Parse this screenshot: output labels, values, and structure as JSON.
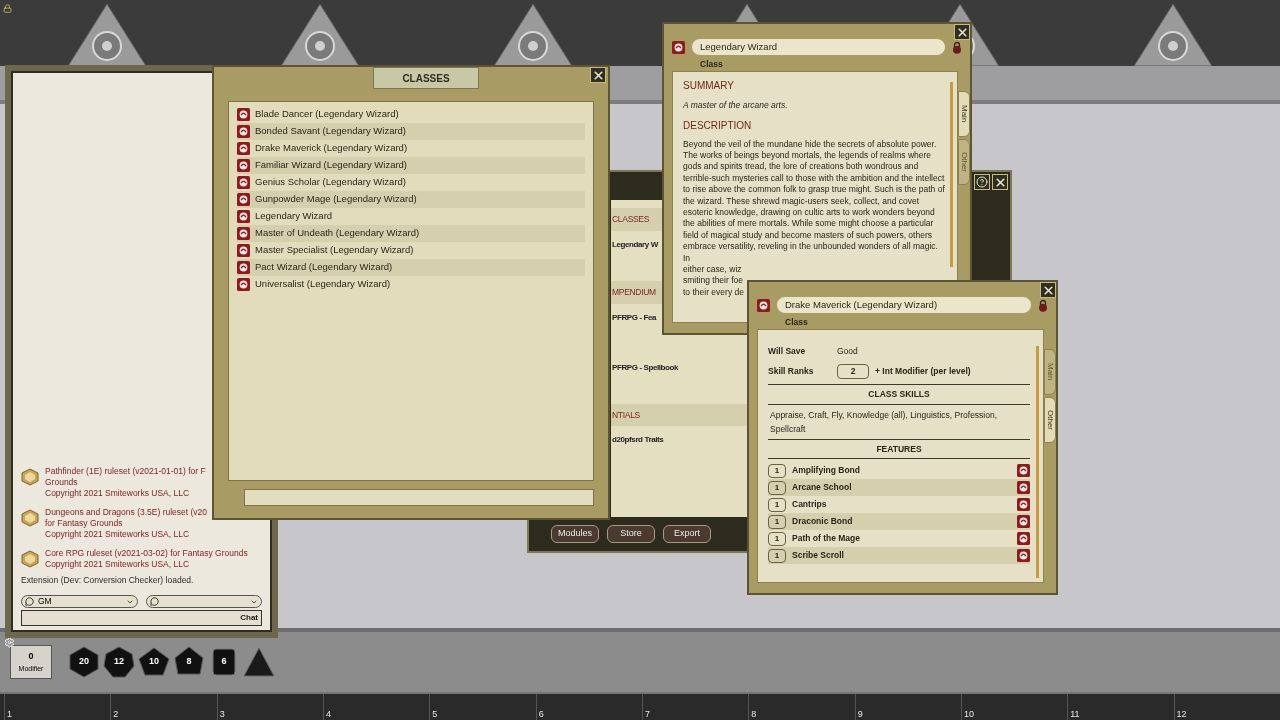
{
  "chat": {
    "entries": [
      {
        "lines": [
          "Pathfinder (1E) ruleset (v2021-01-01) for F",
          "Grounds"
        ],
        "copyright": "Copyright 2021 Smiteworks USA, LLC"
      },
      {
        "lines": [
          "Dungeons and Dragons (3.5E) ruleset (v20",
          "for Fantasy Grounds"
        ],
        "copyright": "Copyright 2021 Smiteworks USA, LLC"
      },
      {
        "lines": [
          "Core RPG ruleset (v2021-03-02) for Fantasy Grounds"
        ],
        "copyright": "Copyright 2021 Smiteworks USA, LLC"
      }
    ],
    "message": "Extension (Dev: Conversion Checker) loaded.",
    "identity": "GM",
    "chat_button": "Chat"
  },
  "dice_tray": {
    "modifier": "0",
    "modifier_label": "Modifier",
    "dice": [
      {
        "kind": "d20",
        "label": "20"
      },
      {
        "kind": "d12",
        "label": "12"
      },
      {
        "kind": "d10",
        "label": "10"
      },
      {
        "kind": "d8",
        "label": "8"
      },
      {
        "kind": "d6",
        "label": "6"
      },
      {
        "kind": "d4"
      }
    ]
  },
  "hotbar": [
    "1",
    "2",
    "3",
    "4",
    "5",
    "6",
    "7",
    "8",
    "9",
    "10",
    "11",
    "12"
  ],
  "classes_window": {
    "title": "CLASSES",
    "items": [
      "Blade Dancer (Legendary Wizard)",
      "Bonded Savant (Legendary Wizard)",
      "Drake Maverick (Legendary Wizard)",
      "Familiar Wizard (Legendary Wizard)",
      "Genius Scholar (Legendary Wizard)",
      "Gunpowder Mage (Legendary Wizard)",
      "Legendary Wizard",
      "Master of Undeath (Legendary Wizard)",
      "Master Specialist (Legendary Wizard)",
      "Pact Wizard (Legendary Wizard)",
      "Universalist (Legendary Wizard)"
    ]
  },
  "library_window": {
    "sections": [
      {
        "title": "CLASSES",
        "items": [
          "Legendary W"
        ]
      },
      {
        "title": "MPENDIUM",
        "items": [
          "PFRPG - Fea",
          "PFRPG - Spellbook"
        ]
      },
      {
        "title": "NTIALS",
        "items": [
          "d20pfsrd Traits"
        ]
      }
    ],
    "buttons": [
      "Modules",
      "Store",
      "Export"
    ]
  },
  "class_window": {
    "name": "Legendary Wizard",
    "type_label": "Class",
    "tabs": [
      {
        "label": "Main",
        "selected": true
      },
      {
        "label": "Other",
        "selected": false
      }
    ],
    "summary_heading": "SUMMARY",
    "summary": "A master of the arcane arts.",
    "description_heading": "DESCRIPTION",
    "description": "Beyond the veil of the mundane hide the secrets of absolute power. The works of beings beyond mortals, the legends of realms where gods and spirits tread, the lore of creations both wondrous and terrible-such mysteries call to those with the ambition and the intellect to rise above the common folk to grasp true might. Such is the path of the wizard. These shrewd magic-users seek, collect, and covet esoteric knowledge, drawing on cultic arts to work wonders beyond the abilities of mere mortals. While some might choose a particular field of magical study and become masters of such powers, others embrace versatility, reveling in the unbounded wonders of all magic. In",
    "description_cut": [
      "either case, wiz",
      "smiting their foe",
      "to their every de"
    ]
  },
  "archetype_window": {
    "name": "Drake Maverick (Legendary Wizard)",
    "type_label": "Class",
    "tabs": [
      {
        "label": "Main",
        "selected": false
      },
      {
        "label": "Other",
        "selected": true
      }
    ],
    "stats": [
      {
        "kind": "text",
        "label": "Will Save",
        "value": "Good"
      },
      {
        "kind": "number",
        "label": "Skill Ranks",
        "value": "2",
        "suffix": "+ Int Modifier (per level)"
      }
    ],
    "class_skills_heading": "CLASS SKILLS",
    "class_skills": "Appraise, Craft, Fly, Knowledge (all), Linguistics, Profession, Spellcraft",
    "features_heading": "FEATURES",
    "features": [
      {
        "level": "1",
        "name": "Amplifying Bond"
      },
      {
        "level": "1",
        "name": "Arcane School"
      },
      {
        "level": "1",
        "name": "Cantrips"
      },
      {
        "level": "1",
        "name": "Draconic Bond"
      },
      {
        "level": "1",
        "name": "Path of the Mage"
      },
      {
        "level": "1",
        "name": "Scribe Scroll"
      }
    ]
  }
}
